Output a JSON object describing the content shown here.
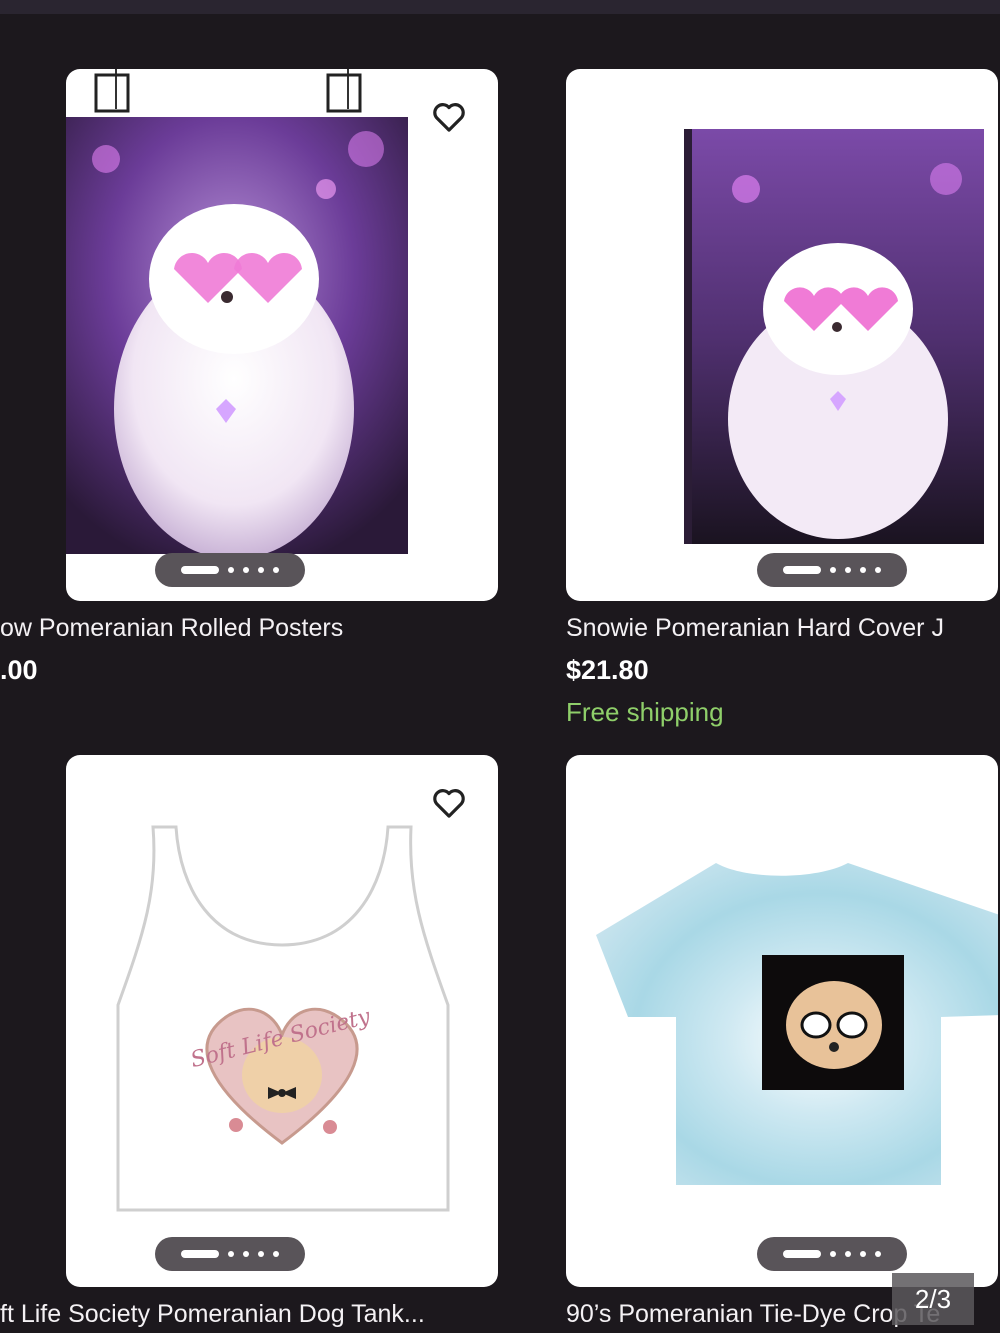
{
  "products": [
    {
      "title": "ow Pomeranian Rolled Posters",
      "price": ".00",
      "shipping": ""
    },
    {
      "title": "Snowie Pomeranian Hard Cover J",
      "price": "$21.80",
      "shipping": "Free shipping"
    },
    {
      "title": "ft Life Society Pomeranian Dog Tank...",
      "price": "",
      "shipping": ""
    },
    {
      "title": "90’s Pomeranian Tie-Dye Crop Te",
      "price": "",
      "shipping": ""
    }
  ],
  "tank_print_text": "Soft Life Society",
  "page_counter": "2/3",
  "colors": {
    "background": "#1c181d",
    "card": "#ffffff",
    "shipping": "#8fcf6a",
    "carousel_pill": "#595459"
  },
  "icons": {
    "favorite": "heart-outline-icon",
    "carousel": "carousel-indicator"
  }
}
